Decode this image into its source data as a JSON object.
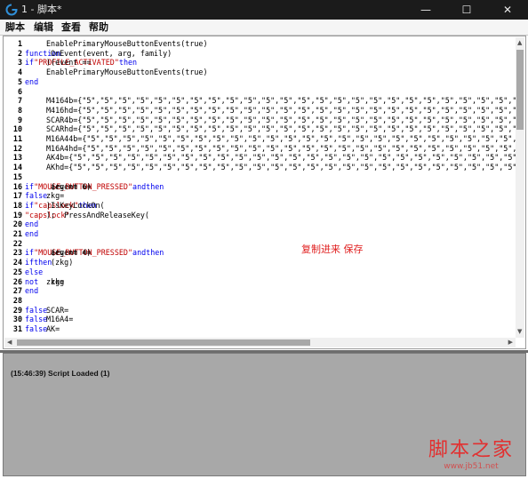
{
  "window": {
    "title": "1 - 脚本*",
    "minimize_symbol": "—",
    "maximize_symbol": "☐",
    "close_symbol": "✕",
    "logo_icon": "logitech-g-logo",
    "accent": "#2f8fd8"
  },
  "menu": [
    "脚本",
    "编辑",
    "查看",
    "帮助"
  ],
  "editor": {
    "lines": [
      {
        "n": "1",
        "seg": [
          {
            "t": "EnablePrimaryMouseButtonEvents(true)",
            "c": "tx"
          }
        ]
      },
      {
        "n": "2",
        "seg": [
          {
            "t": "function",
            "c": "kw"
          },
          {
            "t": " OnEvent(event, arg, family)",
            "c": "tx"
          }
        ]
      },
      {
        "n": "3",
        "seg": [
          {
            "t": "if",
            "c": "kw"
          },
          {
            "t": " (event == ",
            "c": "tx"
          },
          {
            "t": "\"PROFILE_ACTIVATED\"",
            "c": "st"
          },
          {
            "t": ") ",
            "c": "tx"
          },
          {
            "t": "then",
            "c": "kw"
          }
        ]
      },
      {
        "n": "4",
        "seg": [
          {
            "t": "EnablePrimaryMouseButtonEvents(true)",
            "c": "tx"
          }
        ]
      },
      {
        "n": "5",
        "seg": [
          {
            "t": "end",
            "c": "kw"
          }
        ]
      },
      {
        "n": "6",
        "seg": []
      },
      {
        "n": "7",
        "seg": [
          {
            "t": "M4164b={\"5\",\"5\",\"5\",\"5\",\"5\",\"5\",\"5\",\"5\",\"5\",\"5\",\"5\",\"5\",\"5\",\"5\",\"5\",\"5\",\"5\",\"5\",\"5\",\"5\",\"5\",\"5\",\"5\",\"5\",\"5\",\"5\",\"5\",\"5\"",
            "c": "tx"
          }
        ]
      },
      {
        "n": "8",
        "seg": [
          {
            "t": "M416hd={\"5\",\"5\",\"5\",\"5\",\"5\",\"5\",\"5\",\"5\",\"5\",\"5\",\"5\",\"5\",\"5\",\"5\",\"5\",\"5\",\"5\",\"5\",\"5\",\"5\",\"5\",\"5\",\"5\",\"5\",\"5\",\"5\",\"5\",\"5\"",
            "c": "tx"
          }
        ]
      },
      {
        "n": "9",
        "seg": [
          {
            "t": "SCAR4b={\"5\",\"5\",\"5\",\"5\",\"5\",\"5\",\"5\",\"5\",\"5\",\"5\",\"5\",\"5\",\"5\",\"5\",\"5\",\"5\",\"5\",\"5\",\"5\",\"5\",\"5\",\"5\",\"5\",\"5\",\"5\",\"5\",\"5\",\"5\"",
            "c": "tx"
          }
        ]
      },
      {
        "n": "10",
        "seg": [
          {
            "t": "SCARhd={\"5\",\"5\",\"5\",\"5\",\"5\",\"5\",\"5\",\"5\",\"5\",\"5\",\"5\",\"5\",\"5\",\"5\",\"5\",\"5\",\"5\",\"5\",\"5\",\"5\",\"5\",\"5\",\"5\",\"5\",\"5\",\"5\",\"5\",\"5\"",
            "c": "tx"
          }
        ]
      },
      {
        "n": "11",
        "seg": [
          {
            "t": "M16A44b={\"5\",\"5\",\"5\",\"5\",\"5\",\"5\",\"5\",\"5\",\"5\",\"5\",\"5\",\"5\",\"5\",\"5\",\"5\",\"5\",\"5\",\"5\",\"5\",\"5\",\"5\",\"5\",\"5\",\"5\",\"5\",\"5\",\"5\",\"5\"",
            "c": "tx"
          }
        ]
      },
      {
        "n": "12",
        "seg": [
          {
            "t": "M16A4hd={\"5\",\"5\",\"5\",\"5\",\"5\",\"5\",\"5\",\"5\",\"5\",\"5\",\"5\",\"5\",\"5\",\"5\",\"5\",\"5\",\"5\",\"5\",\"5\",\"5\",\"5\",\"5\",\"5\",\"5\",\"5\",\"5\",\"5\",\"5\"",
            "c": "tx"
          }
        ]
      },
      {
        "n": "13",
        "seg": [
          {
            "t": "AK4b={\"5\",\"5\",\"5\",\"5\",\"5\",\"5\",\"5\",\"5\",\"5\",\"5\",\"5\",\"5\",\"5\",\"5\",\"5\",\"5\",\"5\",\"5\",\"5\",\"5\",\"5\",\"5\",\"5\",\"5\",\"5\",\"5\",\"5\",\"5\"",
            "c": "tx"
          }
        ]
      },
      {
        "n": "14",
        "seg": [
          {
            "t": "AKhd={\"5\",\"5\",\"5\",\"5\",\"5\",\"5\",\"5\",\"5\",\"5\",\"5\",\"5\",\"5\",\"5\",\"5\",\"5\",\"5\",\"5\",\"5\",\"5\",\"5\",\"5\",\"5\",\"5\",\"5\",\"5\",\"5\",\"5\",\"5\"",
            "c": "tx"
          }
        ]
      },
      {
        "n": "15",
        "seg": []
      },
      {
        "n": "16",
        "seg": [
          {
            "t": "if",
            "c": "kw"
          },
          {
            "t": " (event == ",
            "c": "tx"
          },
          {
            "t": "\"MOUSE_BUTTON_PRESSED\"",
            "c": "st"
          },
          {
            "t": " ",
            "c": "tx"
          },
          {
            "t": "and",
            "c": "kw"
          },
          {
            "t": " arg == 6) ",
            "c": "tx"
          },
          {
            "t": "then",
            "c": "kw"
          }
        ]
      },
      {
        "n": "17",
        "seg": [
          {
            "t": "zkg=",
            "c": "tx"
          },
          {
            "t": "false",
            "c": "kw"
          }
        ]
      },
      {
        "n": "18",
        "seg": [
          {
            "t": " ",
            "c": "tx"
          },
          {
            "t": "if",
            "c": "kw"
          },
          {
            "t": " IsKeyLockOn(",
            "c": "tx"
          },
          {
            "t": "\"capslock\"",
            "c": "st"
          },
          {
            "t": ") ",
            "c": "tx"
          },
          {
            "t": "then",
            "c": "kw"
          }
        ]
      },
      {
        "n": "19",
        "seg": [
          {
            "t": "    PressAndReleaseKey(",
            "c": "tx"
          },
          {
            "t": "\"capslock\"",
            "c": "st"
          },
          {
            "t": ");",
            "c": "tx"
          }
        ]
      },
      {
        "n": "20",
        "seg": [
          {
            "t": " ",
            "c": "tx"
          },
          {
            "t": "end",
            "c": "kw"
          }
        ]
      },
      {
        "n": "21",
        "seg": [
          {
            "t": "end",
            "c": "kw"
          }
        ]
      },
      {
        "n": "22",
        "seg": []
      },
      {
        "n": "23",
        "seg": [
          {
            "t": "if",
            "c": "kw"
          },
          {
            "t": " (event == ",
            "c": "tx"
          },
          {
            "t": "\"MOUSE_BUTTON_PRESSED\"",
            "c": "st"
          },
          {
            "t": " ",
            "c": "tx"
          },
          {
            "t": "and",
            "c": "kw"
          },
          {
            "t": " arg == 4) ",
            "c": "tx"
          },
          {
            "t": "then",
            "c": "kw"
          }
        ]
      },
      {
        "n": "24",
        "seg": [
          {
            "t": "if",
            "c": "kw"
          },
          {
            "t": " (zkg)",
            "c": "tx"
          },
          {
            "t": "then",
            "c": "kw"
          }
        ]
      },
      {
        "n": "25",
        "seg": [
          {
            "t": "else",
            "c": "kw"
          }
        ]
      },
      {
        "n": "26",
        "seg": [
          {
            "t": "zkg=",
            "c": "tx"
          },
          {
            "t": "not",
            "c": "kw"
          },
          {
            "t": " zkg",
            "c": "tx"
          }
        ]
      },
      {
        "n": "27",
        "seg": [
          {
            "t": "end",
            "c": "kw"
          }
        ]
      },
      {
        "n": "28",
        "seg": []
      },
      {
        "n": "29",
        "seg": [
          {
            "t": "SCAR=",
            "c": "tx"
          },
          {
            "t": "false",
            "c": "kw"
          }
        ]
      },
      {
        "n": "30",
        "seg": [
          {
            "t": "M16A4=",
            "c": "tx"
          },
          {
            "t": "false",
            "c": "kw"
          }
        ]
      },
      {
        "n": "31",
        "seg": [
          {
            "t": "AK=",
            "c": "tx"
          },
          {
            "t": "false",
            "c": "kw"
          }
        ]
      }
    ]
  },
  "annotation": "复制进来 保存",
  "output": {
    "message": "(15:46:39) Script Loaded (1)"
  },
  "watermark": {
    "main": "脚本之家",
    "url": "www.jb51.net"
  }
}
